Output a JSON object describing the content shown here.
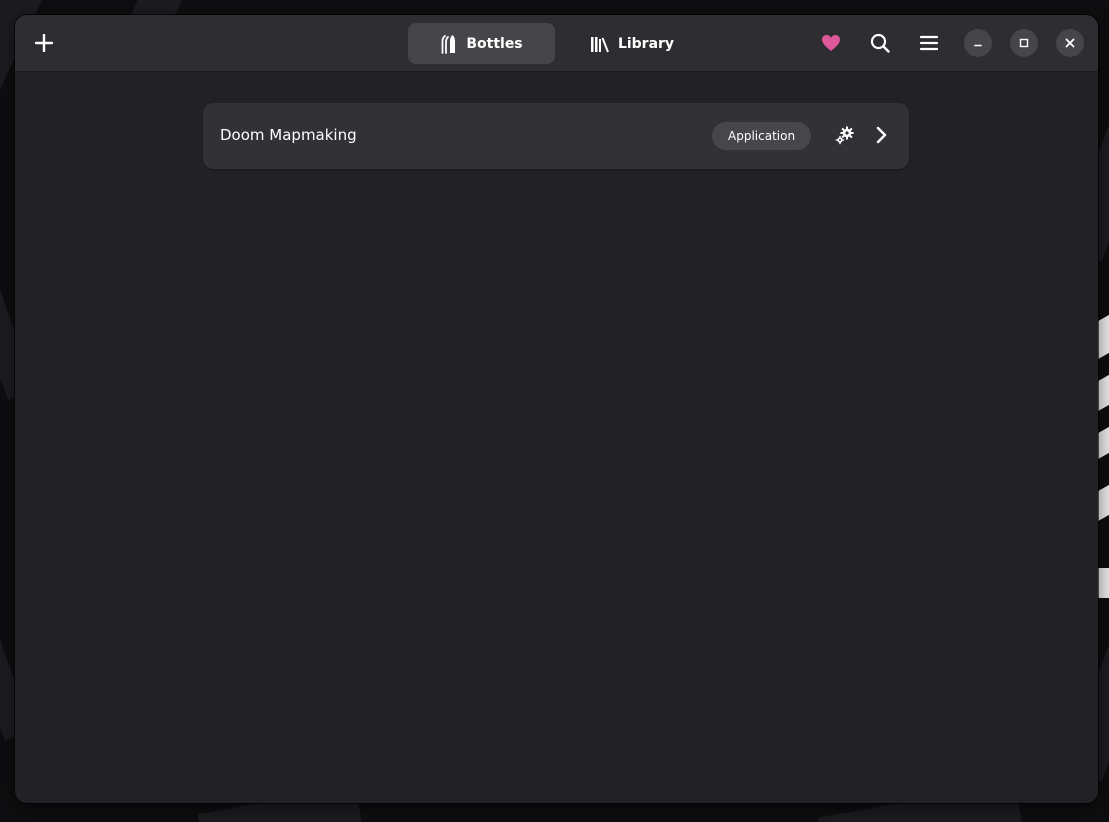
{
  "header": {
    "add_icon": "plus-icon",
    "switcher": [
      {
        "label": "Bottles",
        "icon": "bottles-icon",
        "active": true
      },
      {
        "label": "Library",
        "icon": "library-icon",
        "active": false
      }
    ],
    "donate_icon": "heart-icon",
    "search_icon": "search-icon",
    "menu_icon": "hamburger-menu-icon",
    "window_controls": [
      "minimize-icon",
      "maximize-icon",
      "close-icon"
    ]
  },
  "bottles": [
    {
      "name": "Doom Mapmaking",
      "environment": "Application",
      "run_icon": "gears-icon",
      "open_icon": "chevron-right-icon"
    }
  ],
  "colors": {
    "window_bg": "#222226",
    "headerbar_bg": "#2e2e32",
    "row_bg": "#323236",
    "heart": "#e0589c",
    "badge_bg": "#46464b"
  }
}
